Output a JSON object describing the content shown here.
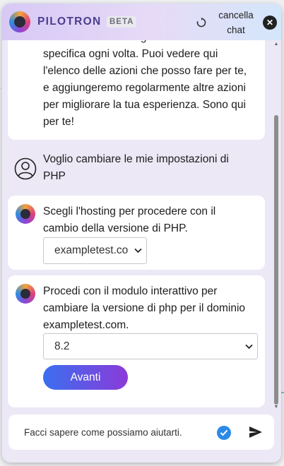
{
  "header": {
    "brand": "PILOTRON",
    "badge": "BETA",
    "clear_label_line1": "cancella",
    "clear_label_line2": "chat"
  },
  "icons": {
    "reset": "reset-icon",
    "close": "close-icon",
    "user": "user-icon",
    "bot": "pilotron-logo",
    "check": "check-icon",
    "send": "send-icon"
  },
  "messages": {
    "intro": {
      "line0": "così non dovrai navigare fino alla sezione",
      "line1": "specifica ogni volta. Puoi vedere qui",
      "line2": "l'elenco delle azioni che posso fare per te,",
      "line3": "e aggiungeremo regolarmente altre azioni",
      "line4": "per migliorare la tua esperienza. Sono qui",
      "line5": "per te!"
    },
    "user": {
      "line1": "Voglio cambiare le mie impostazioni di",
      "line2": "PHP"
    },
    "hosting": {
      "line1": "Scegli l'hosting per procedere con il",
      "line2": "cambio della versione di PHP.",
      "select_value": "exampletest.co"
    },
    "php": {
      "line1": "Procedi con il modulo interattivo per",
      "line2": "cambiare la versione di php per il dominio",
      "line3": "exampletest.com.",
      "select_value": "8.2",
      "button": "Avanti"
    }
  },
  "input": {
    "placeholder": "Facci sapere come possiamo aiutarti."
  },
  "colors": {
    "brand": "#4b3e8e",
    "button_start": "#3a6ff0",
    "button_end": "#8b3ad8",
    "check": "#2b8ae8"
  }
}
